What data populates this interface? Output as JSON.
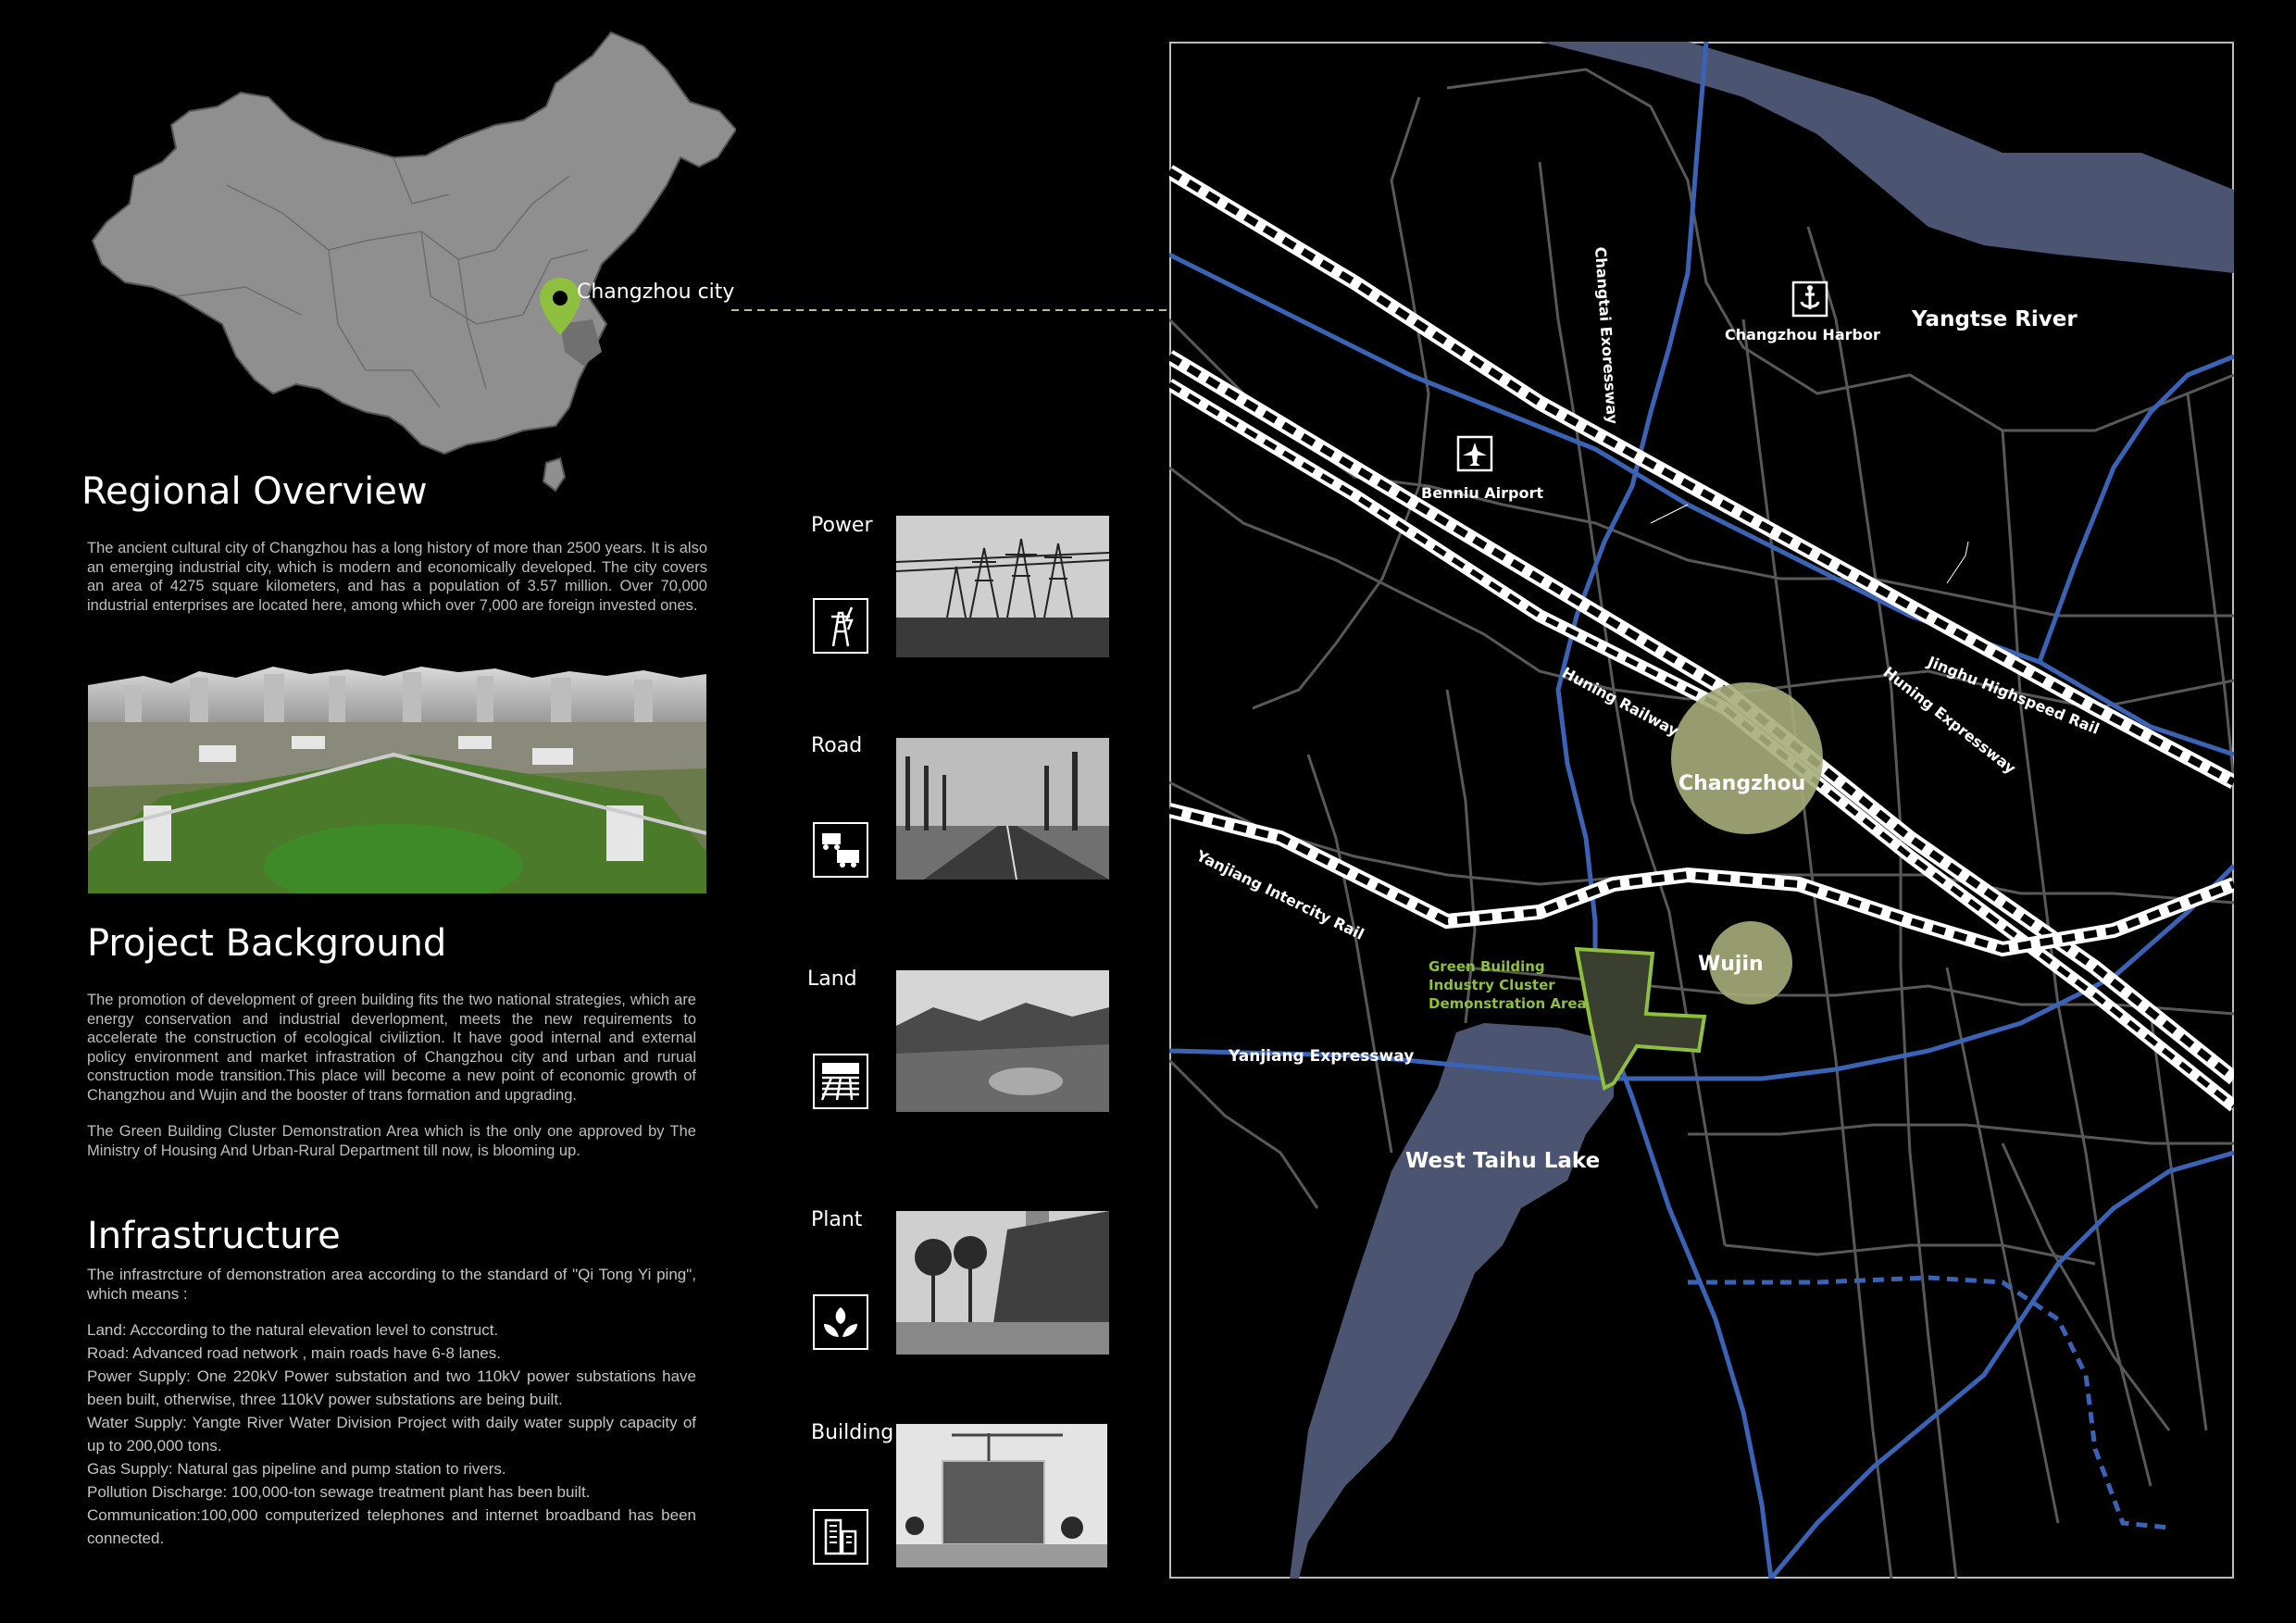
{
  "china_map": {
    "city_label": "Changzhou city",
    "marker_color": "#8fbf3f"
  },
  "regional_overview": {
    "title": "Regional Overview",
    "text": "The ancient cultural city of Changzhou has a long history of more than 2500 years. It is  also an emerging industrial city, which is modern and economically developed. The city covers an area of 4275 square kilometers, and has a population of 3.57 million. Over 70,000 industrial enterprises are located here, among which over 7,000 are foreign invested ones."
  },
  "project_background": {
    "title": "Project Background",
    "para1": "The promotion of development of green building fits the two national strategies, which are energy conservation and industrial deverlopment, meets the new requirements to accelerate the construction of ecological civiliztion. It have good internal and external policy environment and market infrastration of Changzhou city and urban and rurual construction mode transition.This place will become a new point of economic growth of Changzhou and Wujin and the booster of trans formation and upgrading.",
    "para2": "The Green Building Cluster Demonstration Area which is the only one approved by The Ministry of Housing  And Urban-Rural Department till now, is blooming up."
  },
  "infrastructure": {
    "title": "Infrastructure",
    "intro": "The infrastrcture of demonstration area according to the standard of \"Qi Tong Yi ping\", which means :",
    "items": [
      "Land: Acccording to the natural elevation level to construct.",
      "Road: Advanced road network , main roads have 6-8 lanes.",
      "Power Supply: One 220kV Power substation and two 110kV power substations have been built, otherwise, three 110kV power substations are being built.",
      "Water Supply: Yangte River Water Division Project with daily water supply capacity of up to 200,000 tons.",
      "Gas Supply: Natural gas pipeline and pump station to rivers.",
      "Pollution Discharge: 100,000-ton sewage treatment plant has been built.",
      "Communication:100,000 computerized telephones and internet broadband has been connected."
    ],
    "categories": [
      {
        "label": "Power",
        "icon": "power-tower-icon"
      },
      {
        "label": "Road",
        "icon": "vehicles-icon"
      },
      {
        "label": "Land",
        "icon": "farmland-icon"
      },
      {
        "label": "Plant",
        "icon": "leaves-icon"
      },
      {
        "label": "Building",
        "icon": "buildings-icon"
      }
    ]
  },
  "city_map": {
    "labels": {
      "yangtse_river": "Yangtse River",
      "changzhou_harbor": "Changzhou Harbor",
      "benniu_airport": "Benniu Airport",
      "changtai_expressway": "Changtai Exoressway",
      "huning_railway": "Huning Railway",
      "huning_expressway": "Huning Expressway",
      "jinghu_rail": "Jinghu Highspeed Rail",
      "changzhou": "Changzhou",
      "yanjiang_rail": "Yanjiang Intercity Rail",
      "wujin": "Wujin",
      "green_area_1": "Green Building",
      "green_area_2": "Industry Cluster",
      "green_area_3": "Demonstration Area",
      "yanjiang_expressway": "Yanjiang Expressway",
      "west_taihu_lake": "West Taihu Lake"
    },
    "colors": {
      "water": "#4b5470",
      "expressway": "#3b63b5",
      "road": "#5a5a5a",
      "district": "#a6ad7a",
      "green_area": "#8fbf3f"
    }
  }
}
